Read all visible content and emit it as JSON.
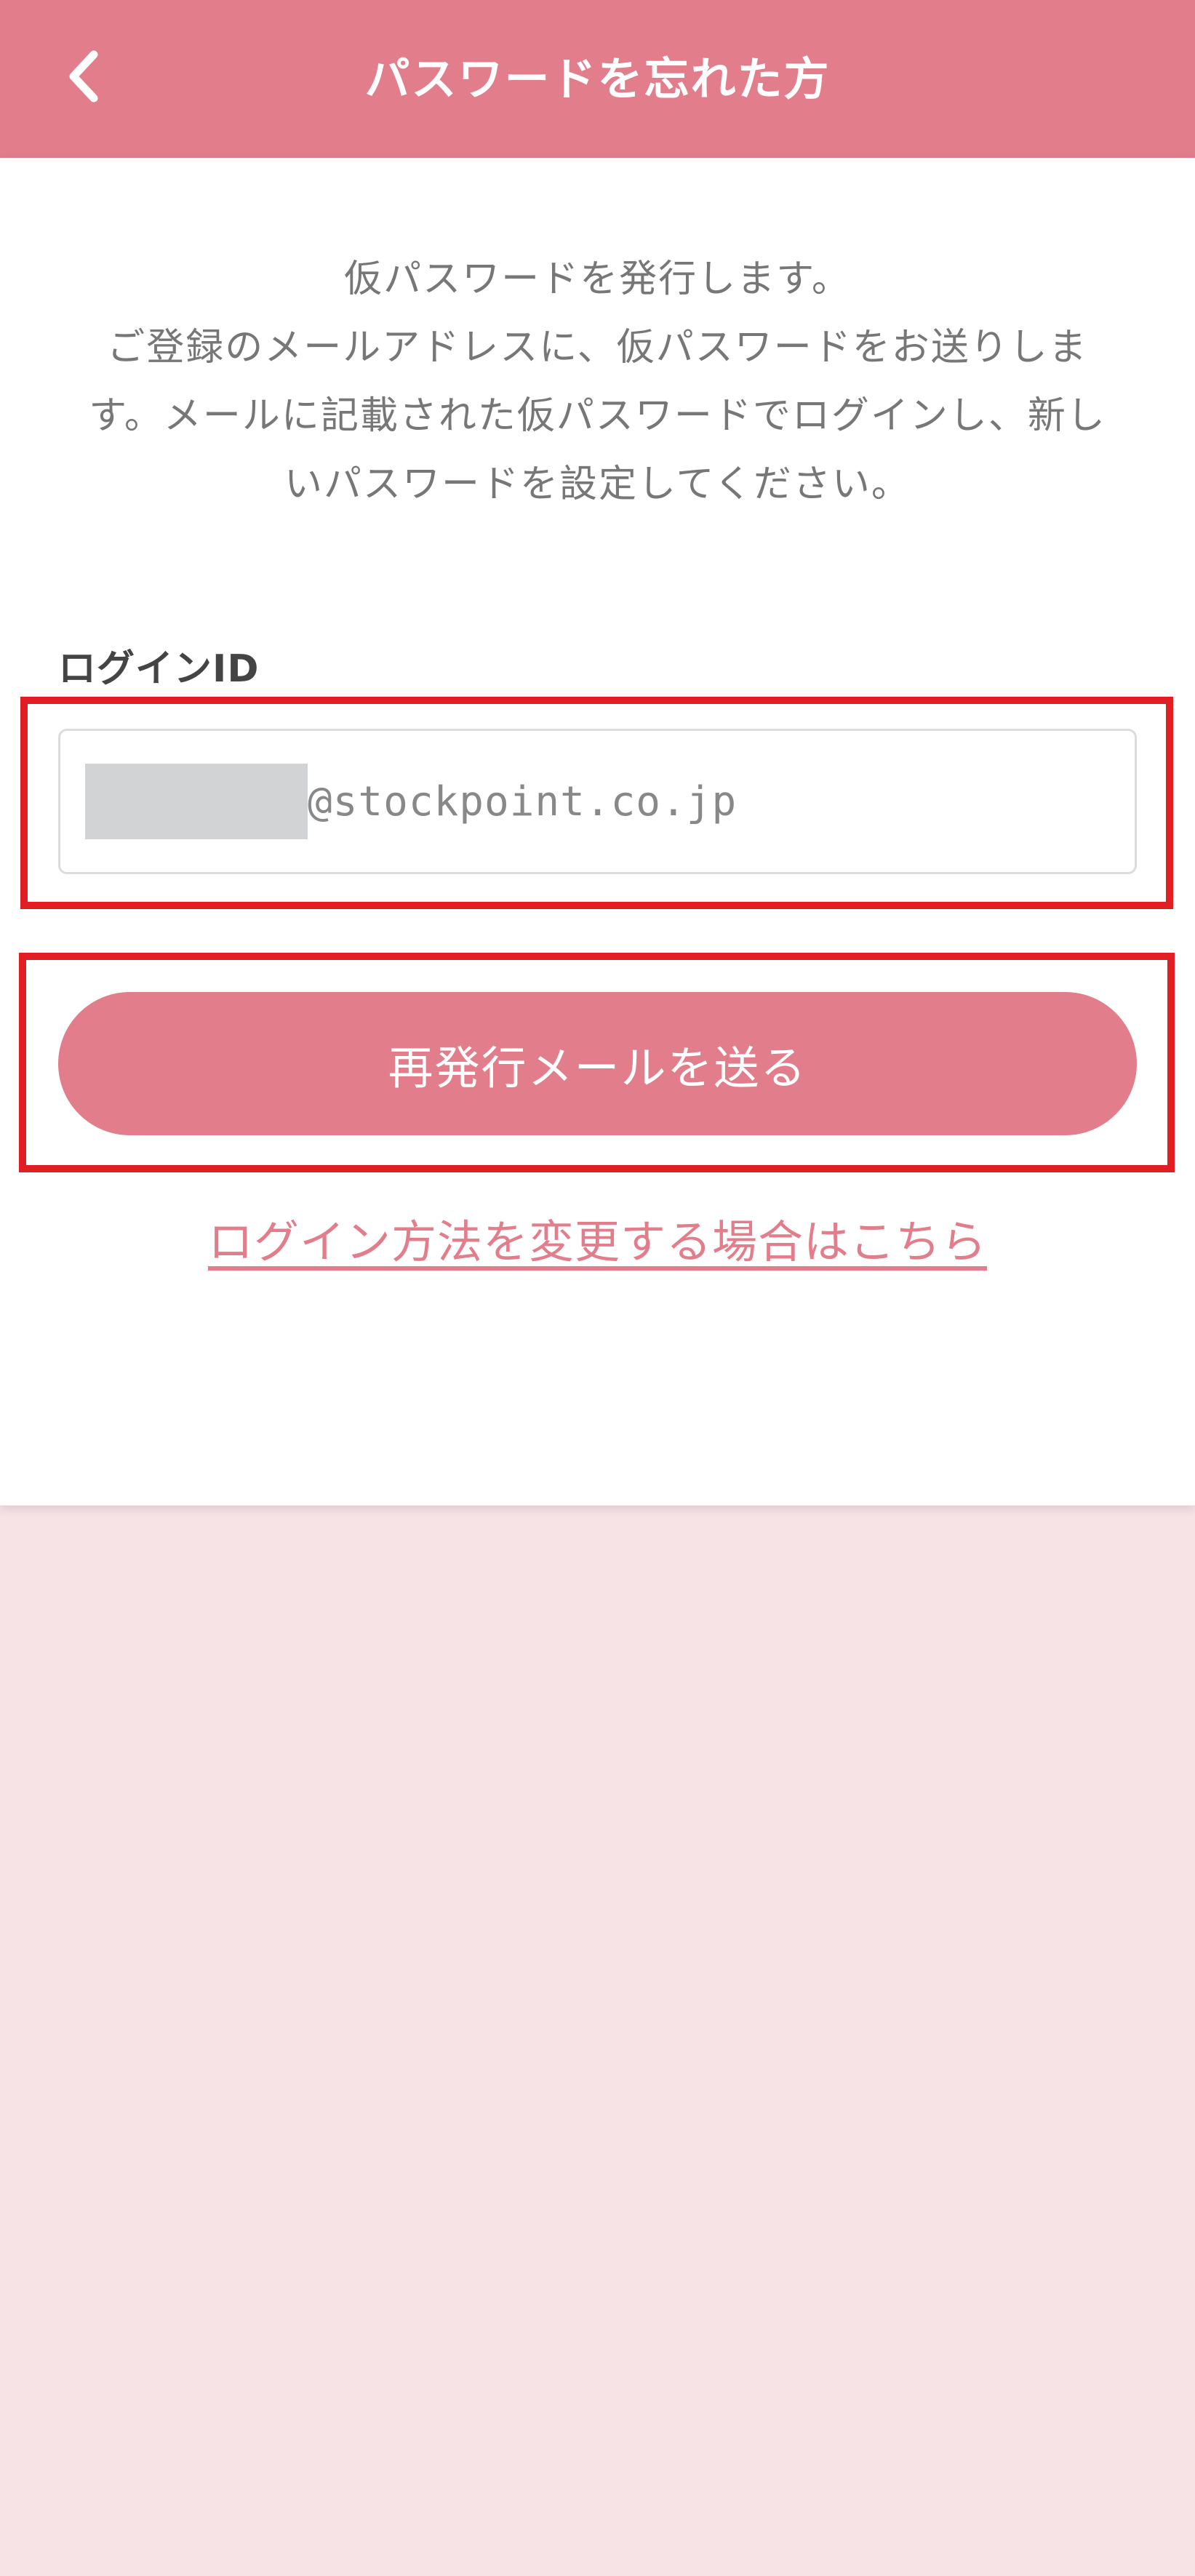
{
  "header": {
    "title": "パスワードを忘れた方",
    "back_icon": "chevron-left-icon"
  },
  "description": "仮パスワードを発行します。\nご登録のメールアドレスに、仮パスワードをお送りしま\nす。メールに記載された仮パスワードでログインし、新し\nいパスワードを設定してください。",
  "form": {
    "login_id_label": "ログインID",
    "login_id_value": "@stockpoint.co.jp"
  },
  "actions": {
    "send_button_label": "再発行メールを送る",
    "change_login_link": "ログイン方法を変更する場合はこちら"
  },
  "colors": {
    "brand": "#e27e8b",
    "highlight": "#e11e23",
    "page_background": "#f7e3e5"
  }
}
